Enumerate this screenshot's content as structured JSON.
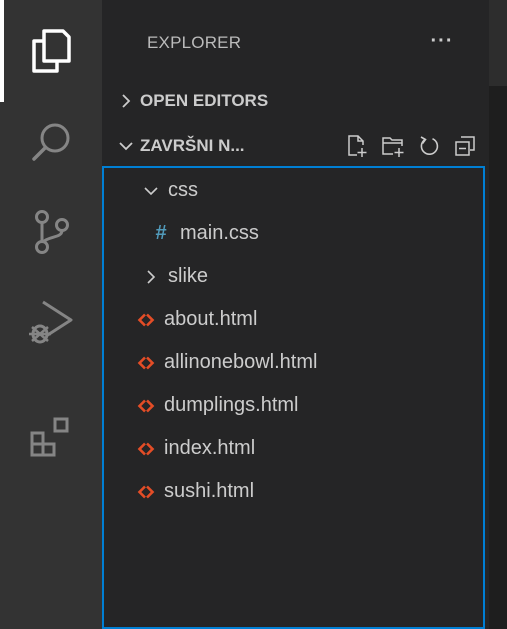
{
  "sidebar": {
    "title": "EXPLORER",
    "more_label": "···",
    "open_editors": {
      "label": "OPEN EDITORS"
    },
    "workspace": {
      "label": "ZAVRŠNI N...",
      "actions": [
        "new-file-icon",
        "new-folder-icon",
        "refresh-icon",
        "collapse-all-icon"
      ]
    },
    "tree": [
      {
        "label": "css",
        "type": "folder",
        "expanded": true
      },
      {
        "label": "main.css",
        "type": "css-file",
        "icon_text": "#"
      },
      {
        "label": "slike",
        "type": "folder",
        "expanded": false
      },
      {
        "label": "about.html",
        "type": "html-file"
      },
      {
        "label": "allinonebowl.html",
        "type": "html-file"
      },
      {
        "label": "dumplings.html",
        "type": "html-file"
      },
      {
        "label": "index.html",
        "type": "html-file"
      },
      {
        "label": "sushi.html",
        "type": "html-file"
      }
    ]
  },
  "activity_bar": {
    "items": [
      "explorer-icon",
      "search-icon",
      "source-control-icon",
      "run-debug-icon",
      "extensions-icon"
    ]
  },
  "colors": {
    "activity_bar_bg": "#333333",
    "sidebar_bg": "#252526",
    "focus_border": "#007fd4",
    "css_hash": "#519aba",
    "html_icon": "#e44d26",
    "text": "#cccccc"
  }
}
